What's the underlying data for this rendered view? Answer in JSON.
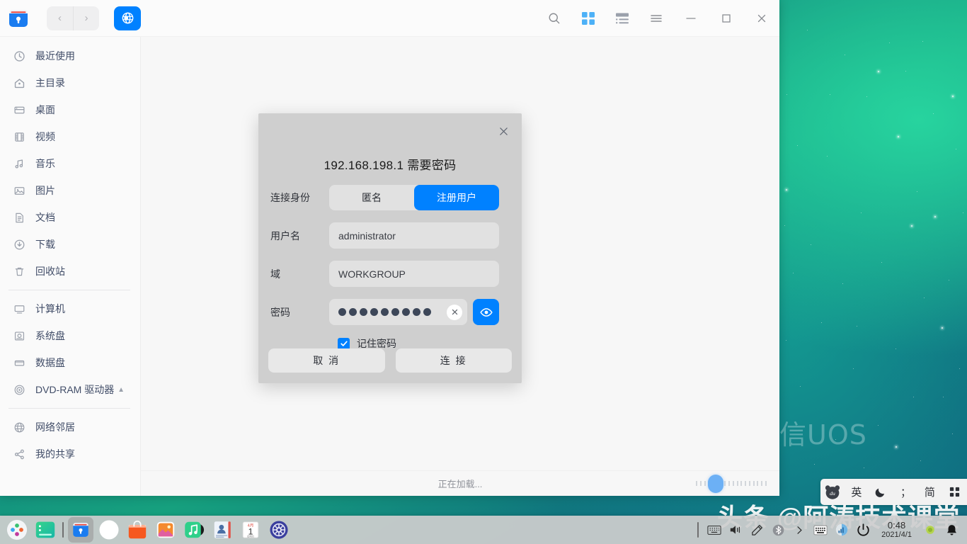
{
  "desktop": {
    "watermark_os": "统信UOS",
    "watermark_channel": "头条 @阿涛技术课堂",
    "wallpaper_colors": {
      "teal": "#16a07e",
      "deep_blue": "#0d5d7a"
    }
  },
  "window": {
    "app_icon_name": "file-manager-icon",
    "nav": {
      "back": "‹",
      "forward": "›"
    },
    "network_button": "network-globe-icon",
    "toolbar": [
      {
        "name": "search-icon",
        "label": "搜索"
      },
      {
        "name": "icon-view-icon",
        "label": "图标视图",
        "active": true
      },
      {
        "name": "list-view-icon",
        "label": "列表视图",
        "active": false
      },
      {
        "name": "menu-icon",
        "label": "菜单"
      }
    ],
    "window_controls": [
      {
        "name": "minimize-button",
        "glyph": "—"
      },
      {
        "name": "maximize-button",
        "glyph": "▢"
      },
      {
        "name": "close-button",
        "glyph": "✕"
      }
    ]
  },
  "sidebar": {
    "groups": [
      {
        "items": [
          {
            "icon": "recent-clock-icon",
            "label": "最近使用"
          },
          {
            "icon": "home-icon",
            "label": "主目录"
          },
          {
            "icon": "desktop-icon",
            "label": "桌面"
          },
          {
            "icon": "video-icon",
            "label": "视频"
          },
          {
            "icon": "music-icon",
            "label": "音乐"
          },
          {
            "icon": "picture-icon",
            "label": "图片"
          },
          {
            "icon": "document-icon",
            "label": "文档"
          },
          {
            "icon": "download-icon",
            "label": "下载"
          },
          {
            "icon": "trash-icon",
            "label": "回收站"
          }
        ]
      },
      {
        "items": [
          {
            "icon": "computer-icon",
            "label": "计算机"
          },
          {
            "icon": "system-disk-icon",
            "label": "系统盘"
          },
          {
            "icon": "data-disk-icon",
            "label": "数据盘"
          },
          {
            "icon": "optical-disc-icon",
            "label": "DVD-RAM 驱动器",
            "eject": true
          }
        ]
      },
      {
        "items": [
          {
            "icon": "network-neighborhood-icon",
            "label": "网络邻居"
          },
          {
            "icon": "share-icon",
            "label": "我的共享"
          }
        ]
      }
    ]
  },
  "statusbar": {
    "status_text": "正在加载...",
    "zoom_slider": {
      "name": "zoom-slider",
      "ticks": 18,
      "handle_position_pct": 17
    }
  },
  "dialog": {
    "title": "192.168.198.1 需要密码",
    "close_glyph": "✕",
    "rows": {
      "identity_label": "连接身份",
      "identity_options": [
        "匿名",
        "注册用户"
      ],
      "identity_selected": "注册用户",
      "username_label": "用户名",
      "username_value": "administrator",
      "domain_label": "域",
      "domain_value": "WORKGROUP",
      "password_label": "密码",
      "password_dots": 9,
      "password_clear_glyph": "✕",
      "password_eye_icon": "eye-icon"
    },
    "remember": {
      "label": "记住密码",
      "checked": true
    },
    "buttons": [
      {
        "name": "cancel-button",
        "label": "取 消"
      },
      {
        "name": "connect-button",
        "label": "连 接"
      }
    ],
    "accent_color": "#0081ff",
    "background_color": "#cfcfcf"
  },
  "ime": {
    "logo": "baidu-ime-logo",
    "items": [
      {
        "name": "ime-language-toggle",
        "label": "英"
      },
      {
        "name": "ime-moon-icon",
        "label": "☾"
      },
      {
        "name": "ime-punctuation-toggle",
        "label": "；"
      },
      {
        "name": "ime-simplified-toggle",
        "label": "简"
      },
      {
        "name": "ime-keyboard-icon",
        "label": "⠿"
      }
    ]
  },
  "taskbar": {
    "apps": [
      {
        "name": "launcher-icon",
        "label": "启动器",
        "active": false
      },
      {
        "name": "terminal-icon",
        "label": "终端",
        "active": false
      },
      {
        "name": "file-manager-taskbar-icon",
        "label": "文件管理器",
        "active": true
      },
      {
        "name": "browser-icon",
        "label": "浏览器",
        "active": false
      },
      {
        "name": "app-store-icon",
        "label": "应用商店",
        "active": false
      },
      {
        "name": "photo-viewer-icon",
        "label": "相册",
        "active": false
      },
      {
        "name": "music-player-icon",
        "label": "音乐",
        "active": false
      },
      {
        "name": "contacts-icon",
        "label": "通讯录",
        "active": false
      },
      {
        "name": "calendar-icon",
        "label": "日历",
        "day": "1",
        "month": "4月",
        "active": false
      },
      {
        "name": "control-center-icon",
        "label": "控制中心",
        "active": false
      }
    ],
    "tray": [
      {
        "name": "keyboard-icon",
        "label": "键盘"
      },
      {
        "name": "volume-icon",
        "label": "音量"
      },
      {
        "name": "pen-icon",
        "label": "手写"
      },
      {
        "name": "bluetooth-icon",
        "label": "蓝牙"
      },
      {
        "name": "chevron-right-icon",
        "label": "展开"
      },
      {
        "name": "onboard-keyboard-icon",
        "label": "屏幕键盘"
      },
      {
        "name": "network-signal-icon",
        "label": "网络"
      },
      {
        "name": "power-icon",
        "label": "电源"
      }
    ],
    "clock": {
      "time": "0:48",
      "date": "2021/4/1"
    },
    "tray_after": [
      {
        "name": "battery-status-icon",
        "label": "电量"
      },
      {
        "name": "notification-bell-icon",
        "label": "通知"
      }
    ]
  }
}
